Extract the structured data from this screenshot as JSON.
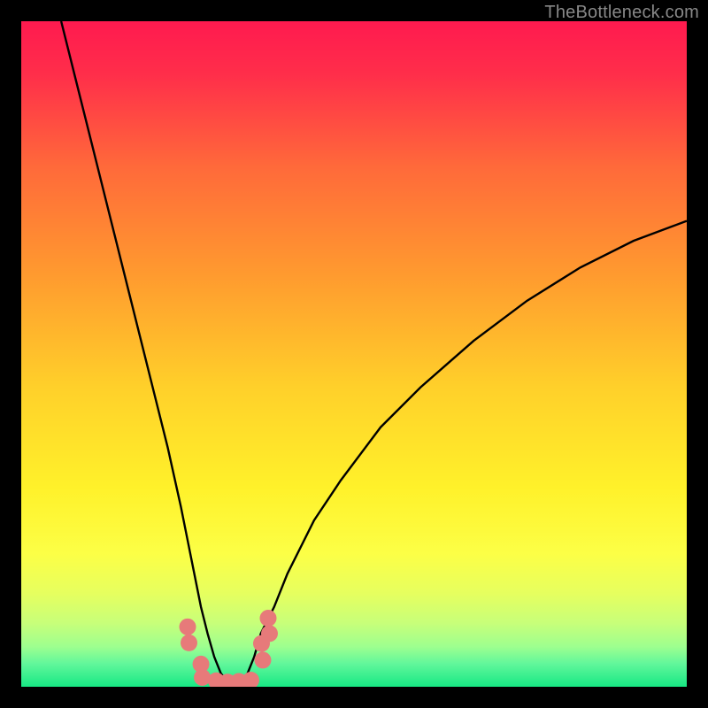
{
  "watermark": "TheBottleneck.com",
  "colors": {
    "stops": [
      {
        "offset": 0,
        "color": "#ff1a4f"
      },
      {
        "offset": 0.08,
        "color": "#ff2e4a"
      },
      {
        "offset": 0.22,
        "color": "#ff6a3a"
      },
      {
        "offset": 0.38,
        "color": "#ff9a2f"
      },
      {
        "offset": 0.55,
        "color": "#ffd02a"
      },
      {
        "offset": 0.7,
        "color": "#fff12a"
      },
      {
        "offset": 0.8,
        "color": "#fcff46"
      },
      {
        "offset": 0.86,
        "color": "#e6ff5f"
      },
      {
        "offset": 0.905,
        "color": "#c7ff7a"
      },
      {
        "offset": 0.94,
        "color": "#9dff8f"
      },
      {
        "offset": 0.965,
        "color": "#62f79b"
      },
      {
        "offset": 1.0,
        "color": "#17e884"
      }
    ],
    "curve": "#000000",
    "markers": "#e77a7a",
    "frame": "#000000"
  },
  "chart_data": {
    "type": "line",
    "title": "",
    "xlabel": "",
    "ylabel": "",
    "xlim": [
      0,
      100
    ],
    "ylim": [
      0,
      100
    ],
    "notes": "V-shaped bottleneck curve; y≈0 at optimum near x≈31, rising steeply on both sides. Left branch reaches top (y≈100) around x≈6; right branch reaches y≈70 at x≈100.",
    "series": [
      {
        "name": "bottleneck-curve",
        "x": [
          6,
          8,
          10,
          12,
          14,
          16,
          18,
          20,
          22,
          24,
          25,
          26,
          27,
          28,
          29,
          30,
          31,
          32,
          33,
          34,
          35,
          36,
          38,
          40,
          44,
          48,
          54,
          60,
          68,
          76,
          84,
          92,
          100
        ],
        "y": [
          100,
          92,
          84,
          76,
          68,
          60,
          52,
          44,
          36,
          27,
          22,
          17,
          12,
          8,
          4.5,
          2,
          0.8,
          0.5,
          0.8,
          2,
          4.5,
          8,
          12,
          17,
          25,
          31,
          39,
          45,
          52,
          58,
          63,
          67,
          70
        ]
      }
    ],
    "markers": {
      "name": "highlighted-points",
      "points": [
        {
          "x": 25.0,
          "y": 9.0
        },
        {
          "x": 25.2,
          "y": 6.6
        },
        {
          "x": 27.0,
          "y": 3.4
        },
        {
          "x": 27.2,
          "y": 1.4
        },
        {
          "x": 29.3,
          "y": 0.9
        },
        {
          "x": 31.0,
          "y": 0.7
        },
        {
          "x": 32.7,
          "y": 0.8
        },
        {
          "x": 34.5,
          "y": 1.0
        },
        {
          "x": 36.3,
          "y": 4.0
        },
        {
          "x": 36.1,
          "y": 6.5
        },
        {
          "x": 37.3,
          "y": 8.0
        },
        {
          "x": 37.1,
          "y": 10.3
        }
      ]
    }
  }
}
